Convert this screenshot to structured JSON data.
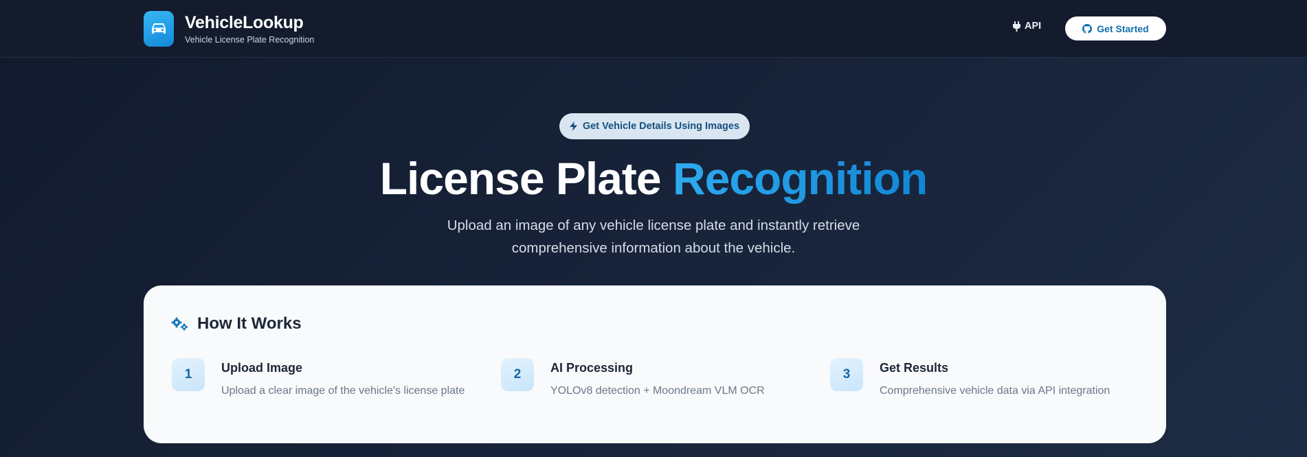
{
  "header": {
    "brand_title": "VehicleLookup",
    "brand_subtitle": "Vehicle License Plate Recognition",
    "logo_icon": "car-icon",
    "nav_api_label": "API",
    "nav_api_icon": "plug-icon",
    "cta_label": "Get Started",
    "cta_icon": "github-icon"
  },
  "hero": {
    "badge_label": "Get Vehicle Details Using Images",
    "badge_icon": "bolt-icon",
    "title_main": "License Plate ",
    "title_accent": "Recognition",
    "description_line1": "Upload an image of any vehicle license plate and instantly retrieve",
    "description_line2": "comprehensive information about the vehicle."
  },
  "how_it_works": {
    "title": "How It Works",
    "icon": "cogs-icon",
    "steps": [
      {
        "number": "1",
        "title": "Upload Image",
        "description": "Upload a clear image of the vehicle's license plate"
      },
      {
        "number": "2",
        "title": "AI Processing",
        "description": "YOLOv8 detection + Moondream VLM OCR"
      },
      {
        "number": "3",
        "title": "Get Results",
        "description": "Comprehensive vehicle data via API integration"
      }
    ]
  },
  "colors": {
    "accent": "#1a9be6",
    "background": "#151f33",
    "card": "#f8fafb"
  }
}
